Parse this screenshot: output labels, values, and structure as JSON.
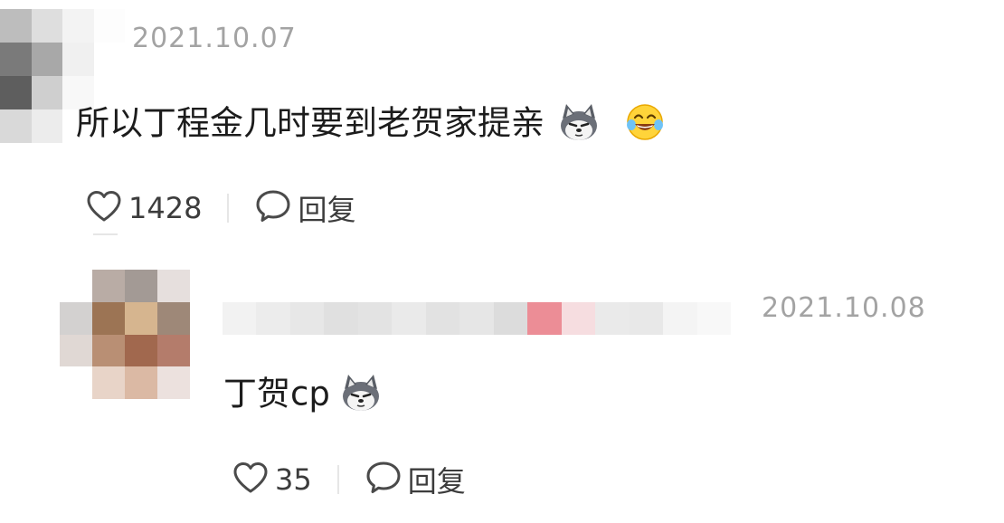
{
  "comments": [
    {
      "timestamp": "2021.10.07",
      "text": "所以丁程金几时要到老贺家提亲",
      "emojis": [
        "wolf-emoji",
        "laughing-tears-emoji"
      ],
      "likes": "1428",
      "reply_label": "回复"
    },
    {
      "timestamp": "2021.10.08",
      "text": "丁贺cp",
      "emojis": [
        "wolf-emoji"
      ],
      "likes": "35",
      "reply_label": "回复"
    }
  ],
  "icons": {
    "like": "heart-outline-icon",
    "reply": "speech-bubble-icon"
  },
  "colors": {
    "text": "#1c1c1c",
    "timestamp": "#a3a3a3",
    "action": "#3c3c3c",
    "separator": "#e6e6e6"
  },
  "avatar1_pixels": [
    "#bdbdbd",
    "#dedede",
    "#f3f3f3",
    "#fdfdfd",
    "#7a7a7a",
    "#a8a8a8",
    "#f0f0f0",
    "#ffffff",
    "#5e5e5e",
    "#cfcfcf",
    "#f8f8f8",
    "#ffffff",
    "#d9d9d9",
    "#ececec",
    "#ffffff",
    "#ffffff"
  ],
  "avatar2_pixels": [
    "#ffffff",
    "#b9aca5",
    "#a39a95",
    "#e6dfdd",
    "#d3d1d0",
    "#9c7454",
    "#d6b58f",
    "#9e8878",
    "#e0d8d4",
    "#b98f74",
    "#a1684e",
    "#b47c6b",
    "#ffffff",
    "#e8d4c8",
    "#dbb9a4",
    "#ece1de"
  ],
  "username_pixels": [
    "#f2f2f2",
    "#ececec",
    "#e7e7e7",
    "#e0e0e0",
    "#e3e3e3",
    "#eaeaea",
    "#e2e2e2",
    "#e6e6e6",
    "#dcdcdc",
    "#ec8d96",
    "#f6dde0",
    "#eaeaea",
    "#e8e8e8",
    "#f4f4f4",
    "#f8f8f8"
  ]
}
